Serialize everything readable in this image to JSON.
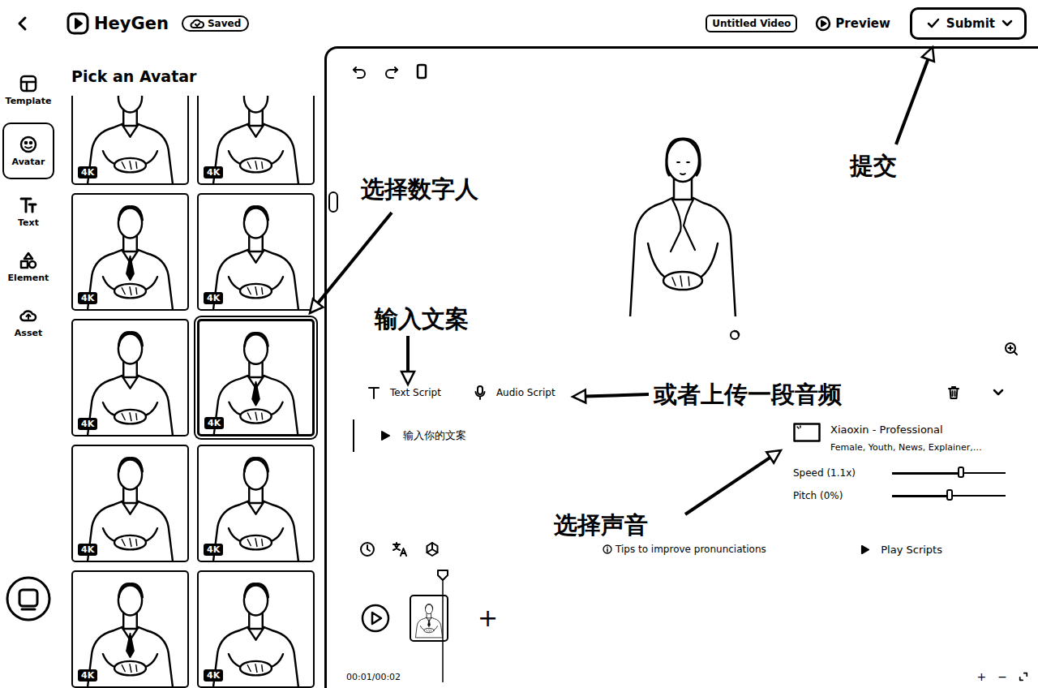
{
  "topbar": {
    "logo": "HeyGen",
    "saved": "Saved",
    "title": "Untitled Video",
    "preview": "Preview",
    "submit": "Submit"
  },
  "rail": [
    {
      "label": "Template",
      "selected": false
    },
    {
      "label": "Avatar",
      "selected": true
    },
    {
      "label": "Text",
      "selected": false
    },
    {
      "label": "Element",
      "selected": false
    },
    {
      "label": "Asset",
      "selected": false
    }
  ],
  "panel": {
    "title": "Pick an Avatar",
    "avatars": [
      {
        "badge": "4K",
        "selected": false
      },
      {
        "badge": "4K",
        "selected": false
      },
      {
        "badge": "4K",
        "selected": false
      },
      {
        "badge": "4K",
        "selected": false
      },
      {
        "badge": "4K",
        "selected": false
      },
      {
        "badge": "4K",
        "selected": true
      },
      {
        "badge": "4K",
        "selected": false
      },
      {
        "badge": "4K",
        "selected": false
      },
      {
        "badge": "4K",
        "selected": false
      },
      {
        "badge": "4K",
        "selected": false
      }
    ]
  },
  "script": {
    "tabs": [
      "Text Script",
      "Audio Script"
    ],
    "text": "输入你的文案"
  },
  "voice": {
    "name": "Xiaoxin - Professional",
    "tags": "Female, Youth, News, Explainer,…"
  },
  "sliders": [
    {
      "label": "Speed (1.1x)",
      "level": 0.6
    },
    {
      "label": "Pitch (0%)",
      "level": 0.5
    }
  ],
  "tips": "Tips to improve pronunciations",
  "play_scripts": "Play Scripts",
  "timeline": {
    "add": "+",
    "time": "00:01/00:02",
    "zoom": [
      "+",
      "−"
    ]
  },
  "annotations": [
    {
      "text": "提交"
    },
    {
      "text": "选择数字人"
    },
    {
      "text": "输入文案"
    },
    {
      "text": "或者上传一段音频"
    },
    {
      "text": "选择声音"
    }
  ]
}
